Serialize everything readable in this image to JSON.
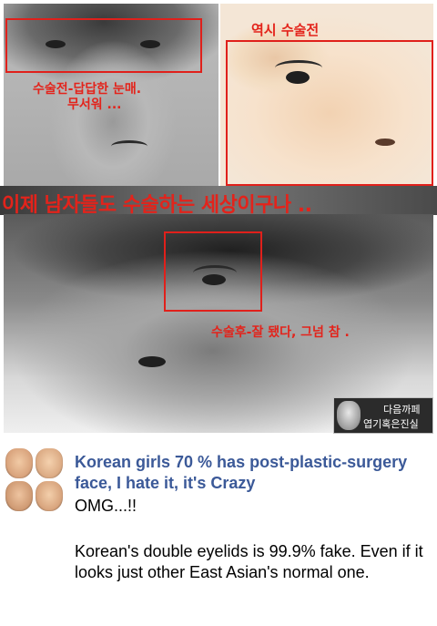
{
  "meme": {
    "label_top_right": "역시 수술전",
    "label_before_line1": "수술전-답답한 눈매.",
    "label_before_line2": "무서워 ...",
    "caption": "이제 남자들도 수술하는 세상이구나 ..",
    "label_after": "수술후-잘 됐다, 그넘 참 .",
    "watermark_line1": "다음까페",
    "watermark_line2": "엽기혹은진실",
    "accent_color": "#e0201b"
  },
  "post": {
    "thumbnail": "face-collage-image",
    "title": "Korean girls 70 % has post-plastic-surgery face, I hate it, it's Crazy",
    "line1": "OMG...!!",
    "paragraph": "Korean's double eyelids is 99.9% fake. Even if it looks just other East Asian's normal one.",
    "title_color": "#3b5998"
  }
}
